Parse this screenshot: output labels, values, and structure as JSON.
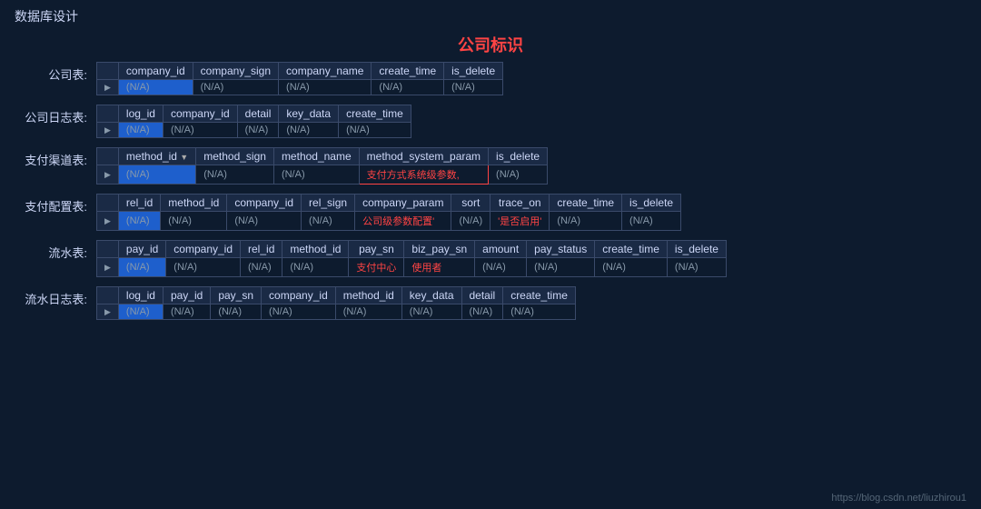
{
  "page": {
    "title": "数据库设计",
    "center_label": "公司标识",
    "footer_url": "https://blog.csdn.net/liuzhirou1"
  },
  "tables": [
    {
      "label": "公司表:",
      "columns": [
        "company_id",
        "company_sign",
        "company_name",
        "create_time",
        "is_delete"
      ],
      "row": [
        "(N/A)",
        "(N/A)",
        "(N/A)",
        "(N/A)",
        "(N/A)"
      ],
      "first_blue": true
    },
    {
      "label": "公司日志表:",
      "columns": [
        "log_id",
        "company_id",
        "detail",
        "key_data",
        "create_time"
      ],
      "row": [
        "(N/A)",
        "(N/A)",
        "(N/A)",
        "(N/A)",
        "(N/A)"
      ],
      "first_blue": true
    },
    {
      "label": "支付渠道表:",
      "columns": [
        "method_id ▼",
        "method_sign",
        "method_name",
        "method_system_param",
        "is_delete"
      ],
      "row": [
        "(N/A)",
        "(N/A)",
        "(N/A)",
        "支付方式系统级参数,",
        "(N/A)"
      ],
      "first_blue": true,
      "special_col": 3,
      "special_color": "#ff4444"
    },
    {
      "label": "支付配置表:",
      "columns": [
        "rel_id",
        "method_id",
        "company_id",
        "rel_sign",
        "company_param",
        "sort",
        "trace_on",
        "create_time",
        "is_delete"
      ],
      "row": [
        "(N/A)",
        "(N/A)",
        "(N/A)",
        "(N/A)",
        "公司级参数配置'",
        "(N/A)",
        "'是否启用'",
        "(N/A)",
        "(N/A)"
      ],
      "first_blue": true,
      "special_col": 4,
      "special_color": "#ff4444",
      "special_col2": 6,
      "special_color2": "#ff4444"
    },
    {
      "label": "流水表:",
      "columns": [
        "pay_id",
        "company_id",
        "rel_id",
        "method_id",
        "pay_sn",
        "biz_pay_sn",
        "amount",
        "pay_status",
        "create_time",
        "is_delete"
      ],
      "row": [
        "(N/A)",
        "(N/A)",
        "(N/A)",
        "(N/A)",
        "支付中心",
        "使用者",
        "(N/A)",
        "(N/A)",
        "(N/A)",
        "(N/A)"
      ],
      "first_blue": true,
      "special_col": 4,
      "special_color": "#ff4444",
      "special_col2": 5,
      "special_color2": "#ff4444"
    },
    {
      "label": "流水日志表:",
      "columns": [
        "log_id",
        "pay_id",
        "pay_sn",
        "company_id",
        "method_id",
        "key_data",
        "detail",
        "create_time"
      ],
      "row": [
        "(N/A)",
        "(N/A)",
        "(N/A)",
        "(N/A)",
        "(N/A)",
        "(N/A)",
        "(N/A)",
        "(N/A)"
      ],
      "first_blue": true
    }
  ]
}
